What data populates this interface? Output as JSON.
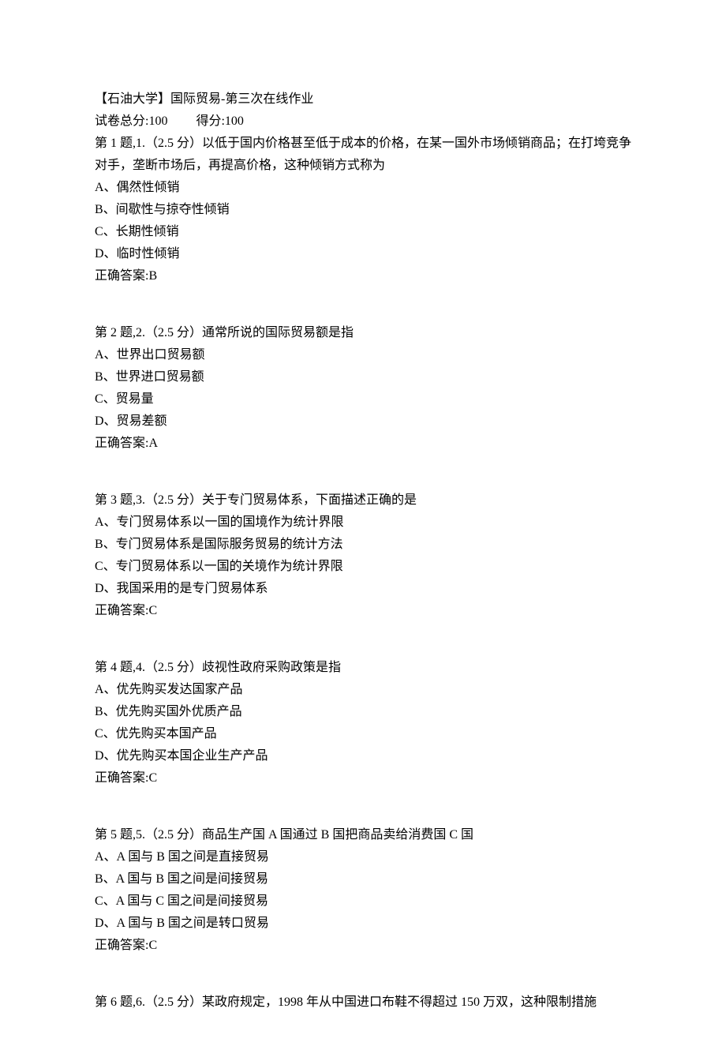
{
  "header": {
    "title": "【石油大学】国际贸易-第三次在线作业",
    "score_label_total": "试卷总分:100",
    "score_label_got": "得分:100"
  },
  "questions": [
    {
      "prompt": "第 1 题,1.（2.5 分）以低于国内价格甚至低于成本的价格，在某一国外市场倾销商品；在打垮竞争对手，垄断市场后，再提高价格，这种倾销方式称为",
      "options": [
        "A、偶然性倾销",
        "B、间歇性与掠夺性倾销",
        "C、长期性倾销",
        "D、临时性倾销"
      ],
      "answer": "正确答案:B"
    },
    {
      "prompt": "第 2 题,2.（2.5 分）通常所说的国际贸易额是指",
      "options": [
        "A、世界出口贸易额",
        "B、世界进口贸易额",
        "C、贸易量",
        "D、贸易差额"
      ],
      "answer": "正确答案:A"
    },
    {
      "prompt": "第 3 题,3.（2.5 分）关于专门贸易体系，下面描述正确的是",
      "options": [
        "A、专门贸易体系以一国的国境作为统计界限",
        "B、专门贸易体系是国际服务贸易的统计方法",
        "C、专门贸易体系以一国的关境作为统计界限",
        "D、我国采用的是专门贸易体系"
      ],
      "answer": "正确答案:C"
    },
    {
      "prompt": "第 4 题,4.（2.5 分）歧视性政府采购政策是指",
      "options": [
        "A、优先购买发达国家产品",
        "B、优先购买国外优质产品",
        "C、优先购买本国产品",
        "D、优先购买本国企业生产产品"
      ],
      "answer": "正确答案:C"
    },
    {
      "prompt": "第 5 题,5.（2.5 分）商品生产国 A 国通过 B 国把商品卖给消费国 C 国",
      "options": [
        "A、A 国与 B 国之间是直接贸易",
        "B、A 国与 B 国之间是间接贸易",
        "C、A 国与 C 国之间是间接贸易",
        "D、A 国与 B 国之间是转口贸易"
      ],
      "answer": "正确答案:C"
    },
    {
      "prompt": "第 6 题,6.（2.5 分）某政府规定，1998 年从中国进口布鞋不得超过 150 万双，这种限制措施",
      "options": [],
      "answer": ""
    }
  ]
}
